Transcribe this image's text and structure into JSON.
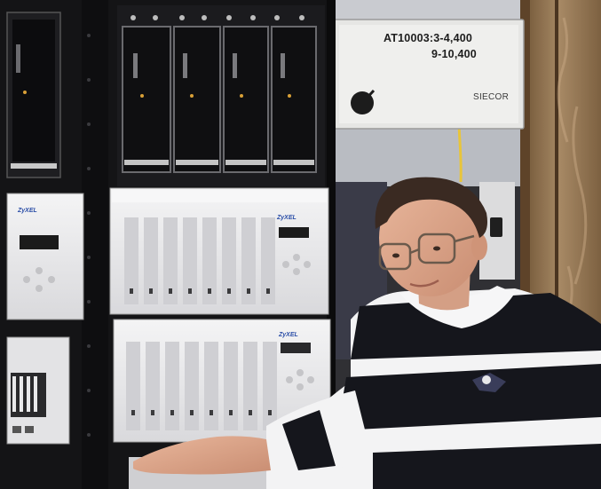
{
  "panel_label": {
    "line1": "AT10003:3-4,400",
    "line2": "9-10,400"
  },
  "panel_brand": "SIECOR",
  "equipment_brand": "ZyXEL",
  "colors": {
    "rack": "#141416",
    "equipment_face": "#e9e9ea",
    "wood_wall": "#8a6f4d",
    "shirt_stripe_dark": "#15161c",
    "shirt_stripe_light": "#f3f3f4"
  }
}
